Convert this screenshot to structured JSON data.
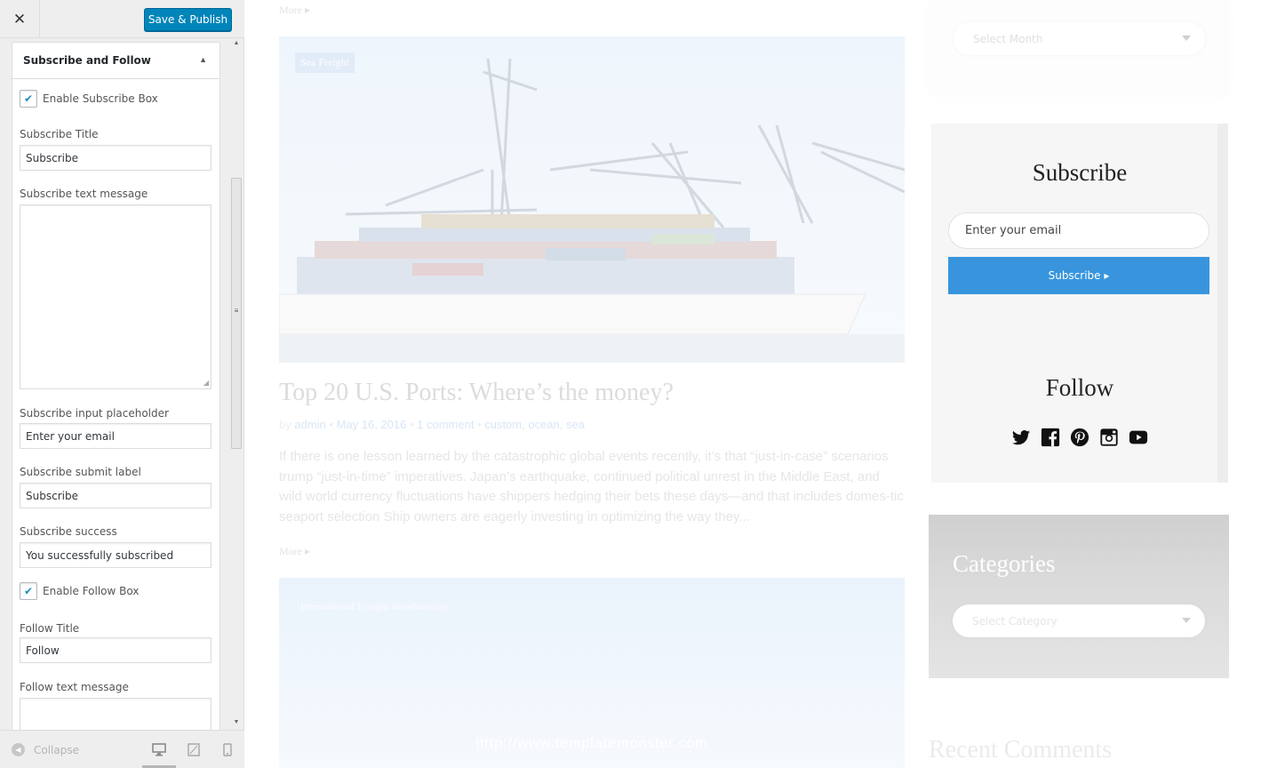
{
  "customizer": {
    "close_label": "✕",
    "publish_label": "Save & Publish",
    "section_title": "Subscribe and Follow",
    "enable_subscribe_label": "Enable Subscribe Box",
    "enable_subscribe_checked": true,
    "fields": {
      "subscribe_title": {
        "label": "Subscribe Title",
        "value": "Subscribe"
      },
      "subscribe_text_message": {
        "label": "Subscribe text message",
        "value": ""
      },
      "subscribe_input_placeholder": {
        "label": "Subscribe input placeholder",
        "value": "Enter your email"
      },
      "subscribe_submit_label": {
        "label": "Subscribe submit label",
        "value": "Subscribe"
      },
      "subscribe_success": {
        "label": "Subscribe success",
        "value": "You successfully subscribed"
      },
      "follow_title": {
        "label": "Follow Title",
        "value": "Follow"
      },
      "follow_text_message": {
        "label": "Follow text message",
        "value": ""
      }
    },
    "enable_follow_label": "Enable Follow Box",
    "enable_follow_checked": true,
    "collapse_label": "Collapse",
    "devices": [
      "desktop-icon",
      "tablet-icon",
      "mobile-icon"
    ],
    "active_device": "desktop"
  },
  "preview": {
    "more_label": "More",
    "post1": {
      "tag": "Sea Freight",
      "title": "Top 20 U.S. Ports: Where’s the money?",
      "meta_by": "by",
      "author": "admin",
      "date": "May 16, 2016",
      "comments": "1 comment",
      "tags": "custom, ocean, sea",
      "excerpt": "If there is one lesson learned by the catastrophic global events recently, it’s that “just-in-case” scenarios trump “just-in-time” imperatives. Japan’s earthquake, continued political unrest in the Middle East, and wild world currency fluctuations have shippers hedging their bets these days—and that includes domes-tic seaport selection Ship owners are eagerly investing in optimizing the way they..."
    },
    "post2": {
      "tags": "International Freight   Warehousing",
      "watermark": "http://www.templatemonster.com"
    },
    "sidebar": {
      "archive_placeholder": "Select Month",
      "subscribe_title": "Subscribe",
      "subscribe_placeholder": "Enter your email",
      "subscribe_button": "Subscribe ▸",
      "follow_title": "Follow",
      "social_icons": [
        "twitter-icon",
        "facebook-icon",
        "pinterest-icon",
        "instagram-icon",
        "youtube-icon"
      ],
      "categories_title": "Categories",
      "categories_placeholder": "Select Category",
      "recent_comments_title": "Recent Comments"
    },
    "colors": {
      "accent_blue": "#3895dd",
      "publish_blue": "#0085ba"
    }
  }
}
